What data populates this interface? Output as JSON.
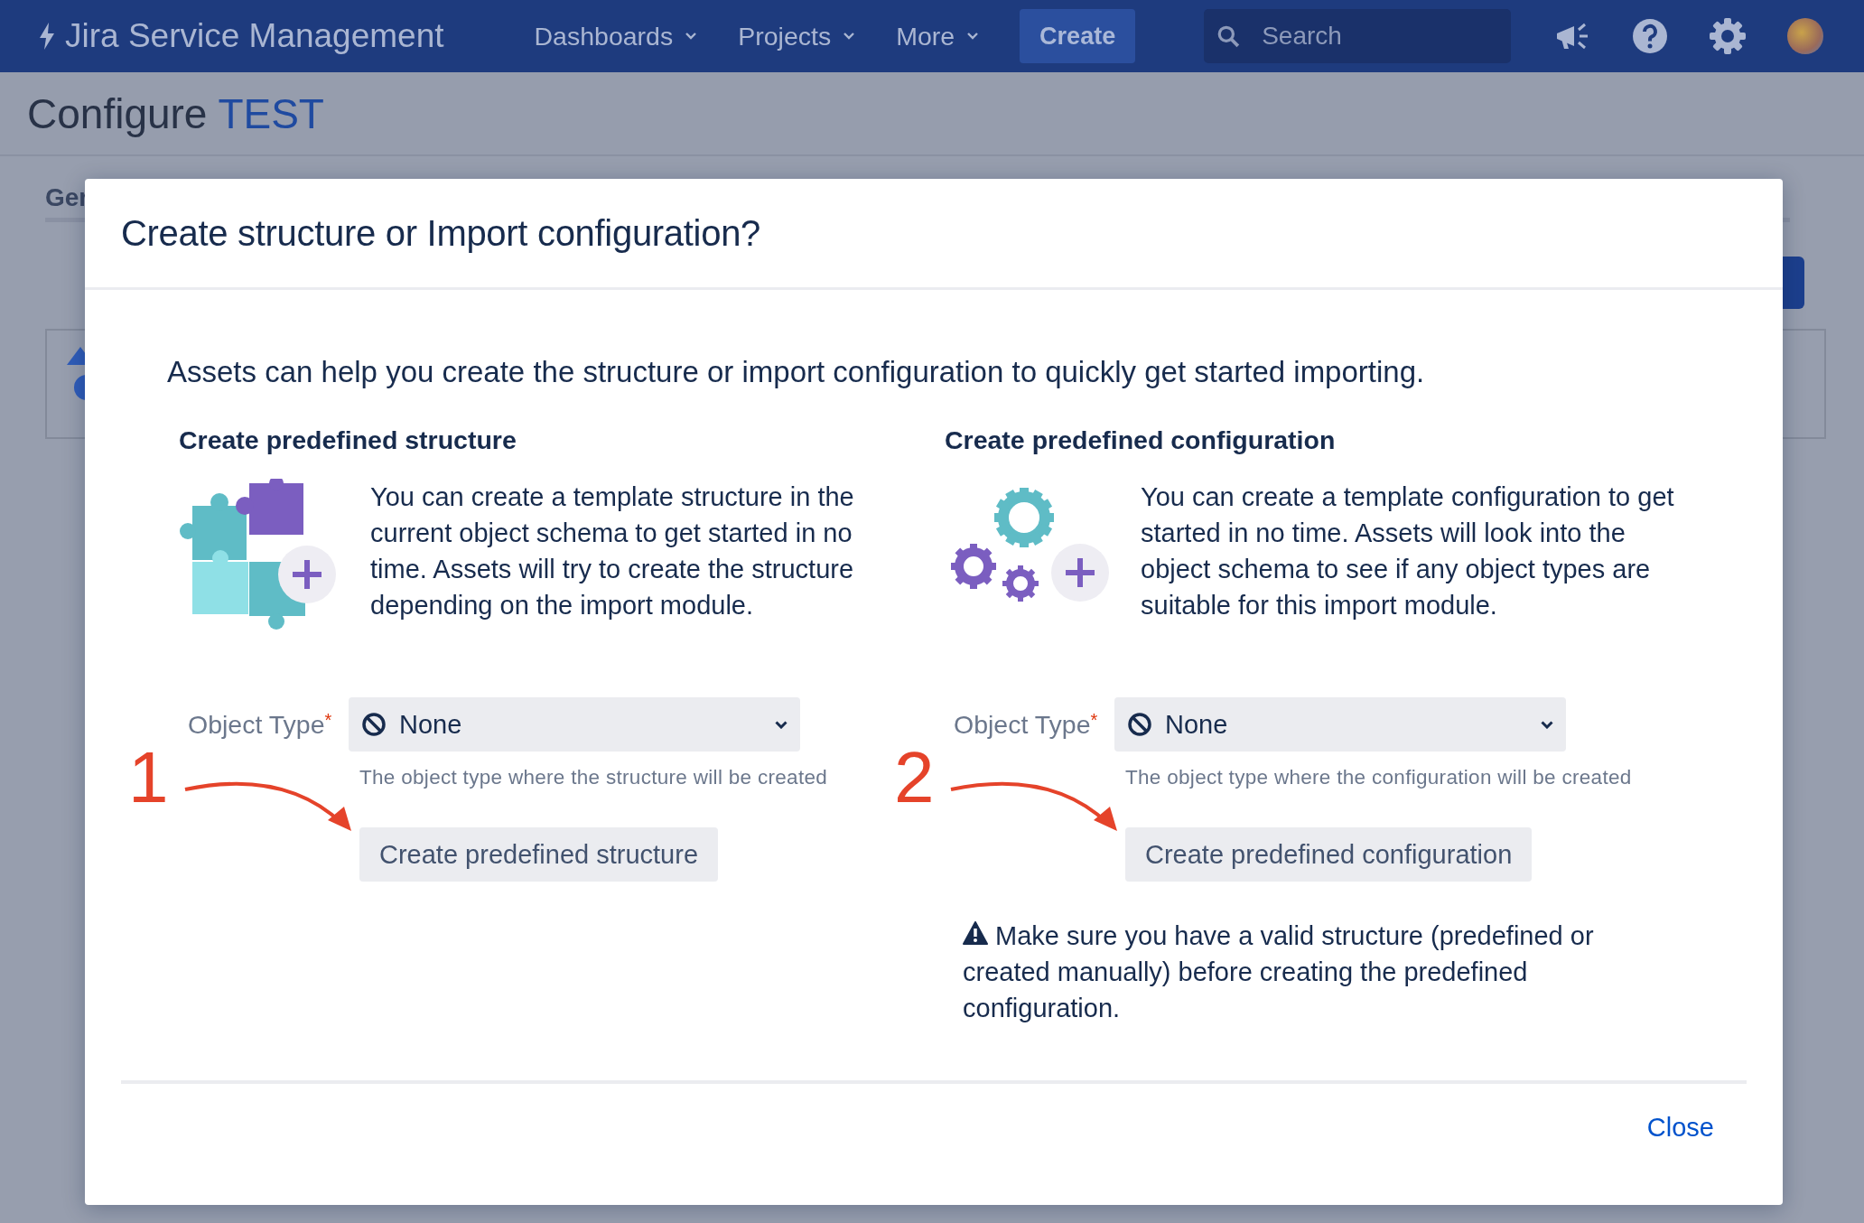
{
  "nav": {
    "product": "Jira Service Management",
    "menus": [
      {
        "label": "Dashboards"
      },
      {
        "label": "Projects"
      },
      {
        "label": "More"
      }
    ],
    "create": "Create",
    "search": {
      "placeholder": "Search"
    }
  },
  "page": {
    "title": "Configure",
    "project": "TEST",
    "section_tab": "Ger"
  },
  "dialog": {
    "title": "Create structure or Import configuration?",
    "intro": "Assets can help you create the structure or import configuration to quickly get started importing.",
    "columns": [
      {
        "kind": "structure",
        "heading": "Create predefined structure",
        "description": "You can create a template structure in the current object schema to get started in no time. Assets will try to create the structure depending on the import module.",
        "field_label": "Object Type",
        "required_mark": "*",
        "select_value": "None",
        "helper": "The object type where the structure will be created",
        "annotation": "1",
        "button": "Create predefined structure"
      },
      {
        "kind": "configuration",
        "heading": "Create predefined configuration",
        "description": "You can create a template configuration to get started in no time. Assets will look into the object schema to see if any object types are suitable for this import module.",
        "field_label": "Object Type",
        "required_mark": "*",
        "select_value": "None",
        "helper": "The object type where the configuration will be created",
        "annotation": "2",
        "button": "Create predefined configuration",
        "warning": "Make sure you have a valid structure (predefined or created manually) before creating the predefined configuration."
      }
    ],
    "close": "Close"
  }
}
